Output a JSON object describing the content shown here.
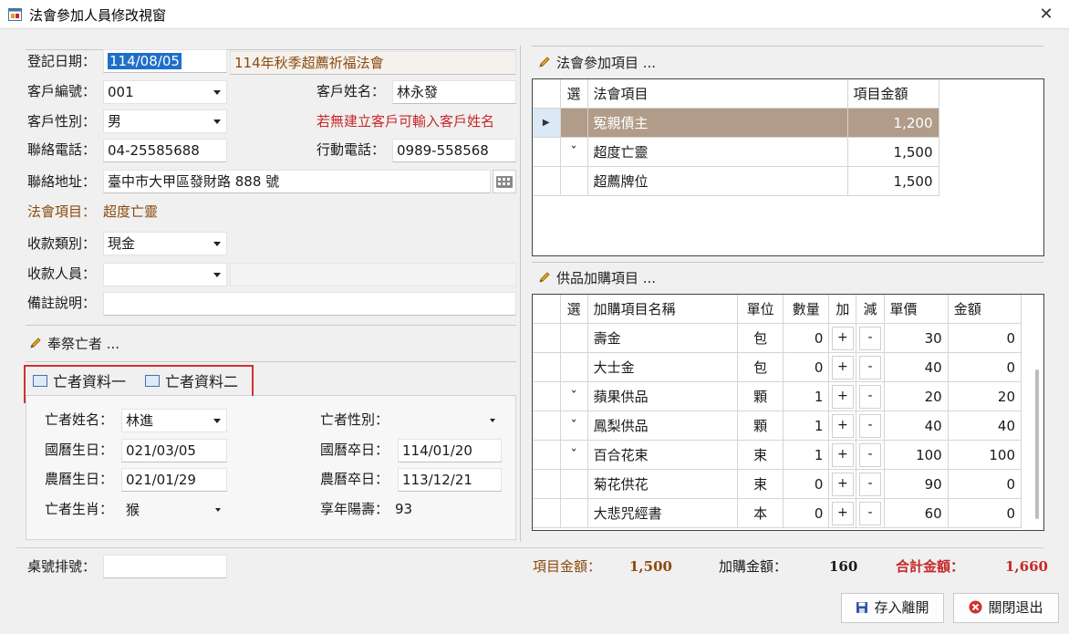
{
  "window": {
    "title": "法會參加人員修改視窗",
    "close_glyph": "✕"
  },
  "form": {
    "reg_date_label": "登記日期：",
    "reg_date_value": "114/08/05",
    "ceremony_name": "114年秋季超薦祈福法會",
    "customer_no_label": "客戶編號：",
    "customer_no_value": "001",
    "customer_name_label": "客戶姓名：",
    "customer_name_value": "林永發",
    "gender_label": "客戶性別：",
    "gender_value": "男",
    "hint_text": "若無建立客戶可輸入客戶姓名",
    "phone_label": "聯絡電話：",
    "phone_value": "04-25585688",
    "mobile_label": "行動電話：",
    "mobile_value": "0989-558568",
    "address_label": "聯絡地址：",
    "address_value": "臺中市大甲區發財路 888 號",
    "item_label": "法會項目：",
    "item_value": "超度亡靈",
    "pay_type_label": "收款類別：",
    "pay_type_value": "現金",
    "payee_label": "收款人員：",
    "payee_value": "",
    "payee_extra": "",
    "note_label": "備註說明：",
    "note_value": ""
  },
  "deceased": {
    "section_title": "奉祭亡者 ...",
    "tabs": [
      "亡者資料一",
      "亡者資料二"
    ],
    "name_label": "亡者姓名：",
    "name_value": "林進",
    "gender_label": "亡者性別：",
    "gender_value": "",
    "birth_label": "國曆生日：",
    "birth_value": "021/03/05",
    "death_label": "國曆卒日：",
    "death_value": "114/01/20",
    "lunar_birth_label": "農曆生日：",
    "lunar_birth_value": "021/01/29",
    "lunar_death_label": "農曆卒日：",
    "lunar_death_value": "113/12/21",
    "zodiac_label": "亡者生肖：",
    "zodiac_value": "猴",
    "age_label": "享年陽壽：",
    "age_value": "93"
  },
  "ceremony_items": {
    "section_title": "法會參加項目 ...",
    "headers": [
      "選",
      "法會項目",
      "項目金額"
    ],
    "rows": [
      {
        "check": "",
        "name": "冤親債主",
        "amount": "1,200",
        "selected": true
      },
      {
        "check": "ˇ",
        "name": "超度亡靈",
        "amount": "1,500",
        "selected": false
      },
      {
        "check": "",
        "name": "超薦牌位",
        "amount": "1,500",
        "selected": false
      }
    ]
  },
  "offerings": {
    "section_title": "供品加購項目 ...",
    "headers": [
      "選",
      "加購項目名稱",
      "單位",
      "數量",
      "加",
      "減",
      "單價",
      "金額"
    ],
    "plus": "+",
    "minus": "-",
    "rows": [
      {
        "check": "",
        "name": "壽金",
        "unit": "包",
        "qty": "0",
        "price": "30",
        "amount": "0"
      },
      {
        "check": "",
        "name": "大士金",
        "unit": "包",
        "qty": "0",
        "price": "40",
        "amount": "0"
      },
      {
        "check": "ˇ",
        "name": "蘋果供品",
        "unit": "顆",
        "qty": "1",
        "price": "20",
        "amount": "20"
      },
      {
        "check": "ˇ",
        "name": "鳳梨供品",
        "unit": "顆",
        "qty": "1",
        "price": "40",
        "amount": "40"
      },
      {
        "check": "ˇ",
        "name": "百合花束",
        "unit": "束",
        "qty": "1",
        "price": "100",
        "amount": "100"
      },
      {
        "check": "",
        "name": "菊花供花",
        "unit": "束",
        "qty": "0",
        "price": "90",
        "amount": "0"
      },
      {
        "check": "",
        "name": "大悲咒經書",
        "unit": "本",
        "qty": "0",
        "price": "60",
        "amount": "0"
      }
    ]
  },
  "footer": {
    "table_no_label": "桌號排號：",
    "table_no_value": "",
    "item_total_label": "項目金額：",
    "item_total_value": "1,500",
    "addon_total_label": "加購金額：",
    "addon_total_value": "160",
    "grand_total_label": "合計金額：",
    "grand_total_value": "1,660",
    "save_button": "存入離開",
    "exit_button": "關閉退出"
  },
  "colors": {
    "brown_text": "#8b4a0f",
    "red_text": "#c62828",
    "selection_blue": "#1e6fc8",
    "selected_row": "#b09c88",
    "tab_highlight_border": "#d32f2f"
  }
}
